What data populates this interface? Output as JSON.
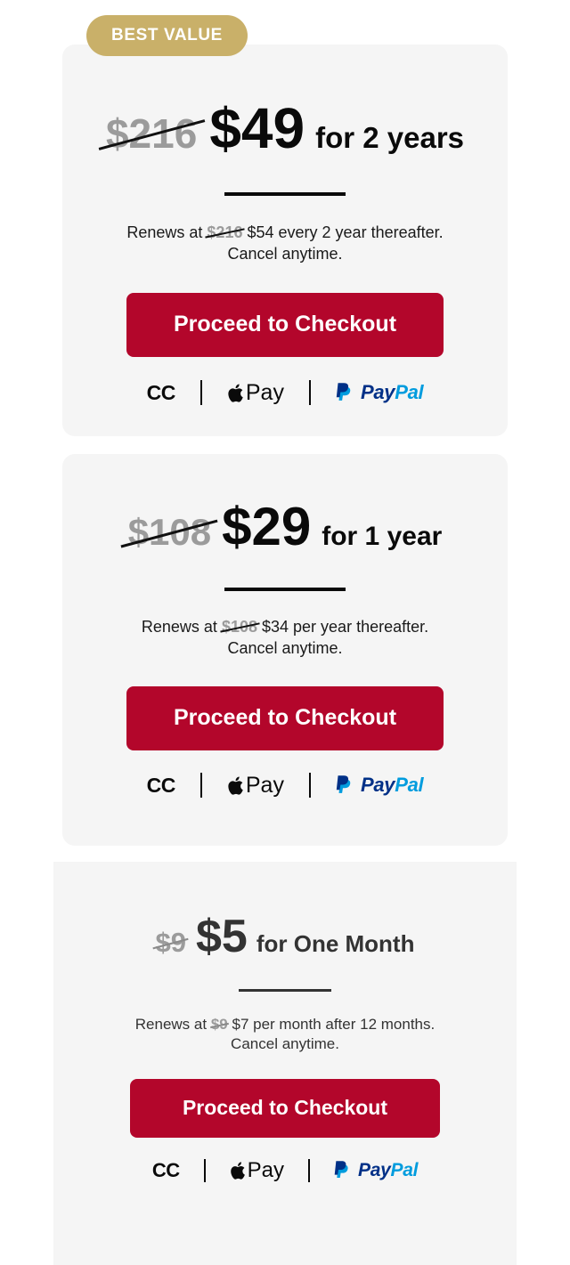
{
  "badge": {
    "label": "BEST VALUE"
  },
  "payment": {
    "cc_label": "CC",
    "apple_pay_label": "Pay",
    "paypal_label_dark": "Pay",
    "paypal_label_light": "Pal",
    "apple_icon": "apple-logo-icon",
    "paypal_icon": "paypal-monogram-icon",
    "separator": "|"
  },
  "colors": {
    "badge_bg": "#c9b069",
    "button_bg": "#b3062b",
    "card_bg": "#f5f5f5",
    "page_bg": "#ffffff",
    "strike_text": "#9b9b9b",
    "paypal_dark": "#003087",
    "paypal_light": "#009cde"
  },
  "plans": [
    {
      "id": "two-year",
      "badge": "BEST VALUE",
      "old_price": "$216",
      "new_price": "$49",
      "term": "for 2 years",
      "renewal_prefix": "Renews at",
      "renewal_old_price": "$216",
      "renewal_line1_rest": "$54 every 2 year thereafter.",
      "renewal_line2": "Cancel anytime.",
      "cta": "Proceed to Checkout"
    },
    {
      "id": "one-year",
      "old_price": "$108",
      "new_price": "$29",
      "term": "for 1 year",
      "renewal_prefix": "Renews at",
      "renewal_old_price": "$108",
      "renewal_line1_rest": "$34 per year thereafter.",
      "renewal_line2": "Cancel anytime.",
      "cta": "Proceed to Checkout"
    },
    {
      "id": "one-month",
      "old_price": "$9",
      "new_price": "$5",
      "term": "for One Month",
      "renewal_prefix": "Renews at",
      "renewal_old_price": "$9",
      "renewal_line1_rest": "$7 per month after 12 months.",
      "renewal_line2": "Cancel anytime.",
      "cta": "Proceed to Checkout"
    }
  ]
}
